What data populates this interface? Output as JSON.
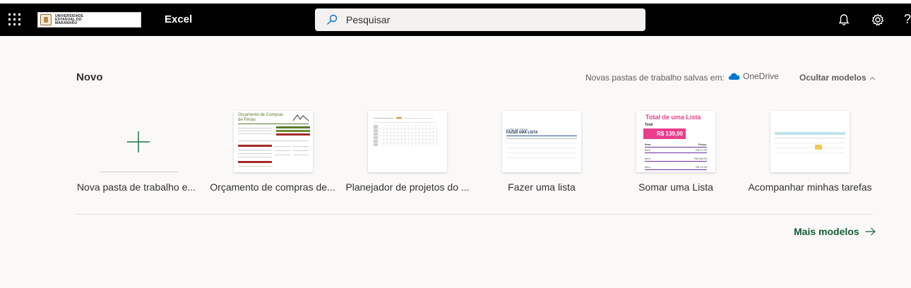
{
  "header": {
    "app_name": "Excel",
    "logo_text": "UNIVERSIDADE ESTADUAL DO MARANHÃO",
    "search_placeholder": "Pesquisar",
    "help_glyph": "?"
  },
  "icons": {
    "waffle": "app-launcher-icon",
    "search": "search-icon",
    "bell": "notifications-icon",
    "gear": "settings-icon",
    "onedrive": "onedrive-cloud-icon",
    "arrow": "arrow-right-icon"
  },
  "section": {
    "title": "Novo",
    "saved_in_label": "Novas pastas de trabalho salvas em:",
    "storage_name": "OneDrive",
    "toggle_templates": "Ocultar modelos",
    "toggle_glyph": "^"
  },
  "templates": [
    {
      "caption": "Nova pasta de trabalho e..."
    },
    {
      "caption": "Orçamento de compras de..."
    },
    {
      "caption": "Planejador de projetos do ..."
    },
    {
      "caption": "Fazer uma lista"
    },
    {
      "caption": "Somar uma Lista"
    },
    {
      "caption": "Acompanhar minhas tarefas"
    }
  ],
  "thumbs": {
    "budget_title": "Orçamento de Compras de Férias",
    "list_title": "FAZER UMA LISTA",
    "list_header": "LISTA DE ITENS",
    "sum_title": "Total de uma Lista",
    "sum_total_label": "Total",
    "sum_total_value": "R$ 139,00",
    "sum_col_item": "Item",
    "sum_col_price": "Preço",
    "sum_rows": [
      {
        "item": "Item",
        "price": "R$ 11,00"
      },
      {
        "item": "Item",
        "price": "R$ 465,00"
      },
      {
        "item": "Item",
        "price": "R$ 10,00"
      }
    ]
  },
  "footer": {
    "more_templates": "Mais modelos"
  },
  "colors": {
    "topbar": "#000000",
    "excel_green": "#185c37",
    "accent_plus": "#217346",
    "onedrive_blue": "#0078d4",
    "sum_pink": "#e83e8c"
  }
}
